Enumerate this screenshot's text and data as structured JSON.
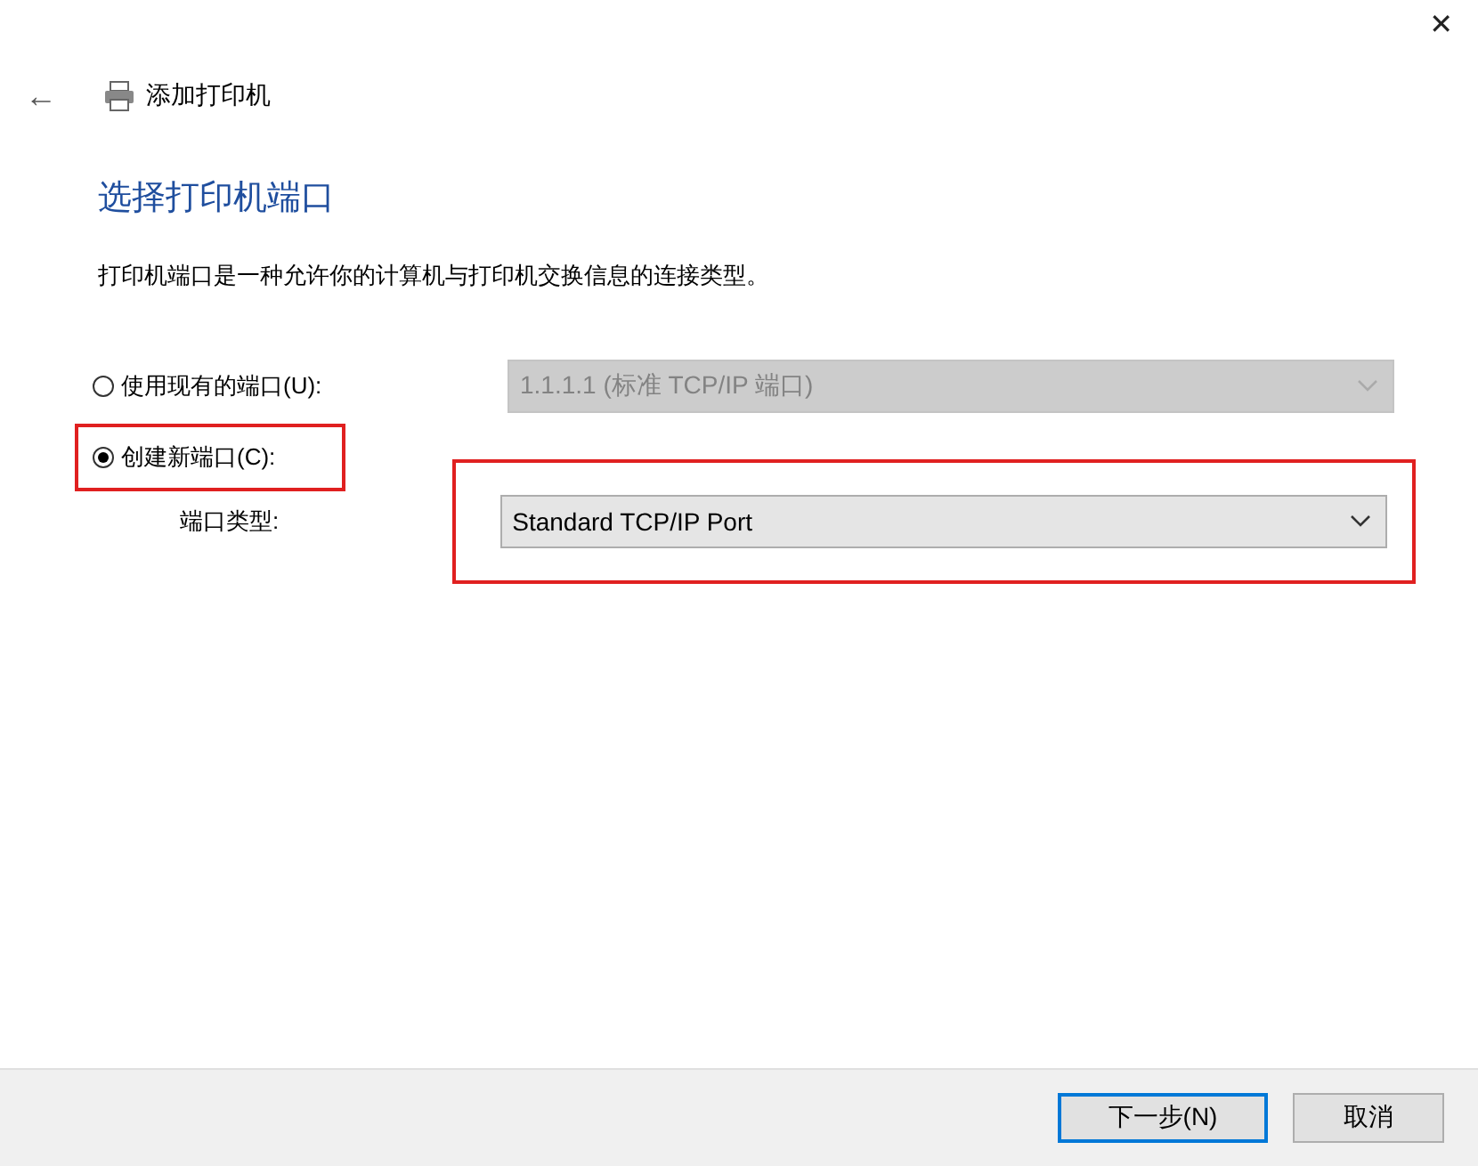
{
  "window": {
    "close": "✕"
  },
  "header": {
    "back": "←",
    "title": "添加打印机"
  },
  "heading": "选择打印机端口",
  "description": "打印机端口是一种允许你的计算机与打印机交换信息的连接类型。",
  "options": [
    {
      "label": "使用现有的端口(U):",
      "selected": false,
      "highlighted": false,
      "dropdown": {
        "value": "1.1.1.1 (标准 TCP/IP 端口)",
        "disabled": true,
        "highlighted": false
      }
    },
    {
      "label": "创建新端口(C):",
      "selected": true,
      "highlighted": true
    }
  ],
  "port_type": {
    "label": "端口类型:",
    "dropdown": {
      "value": "Standard TCP/IP Port",
      "disabled": false,
      "highlighted": true
    }
  },
  "buttons": [
    {
      "label": "下一步(N)",
      "default": true
    },
    {
      "label": "取消",
      "default": false
    }
  ]
}
